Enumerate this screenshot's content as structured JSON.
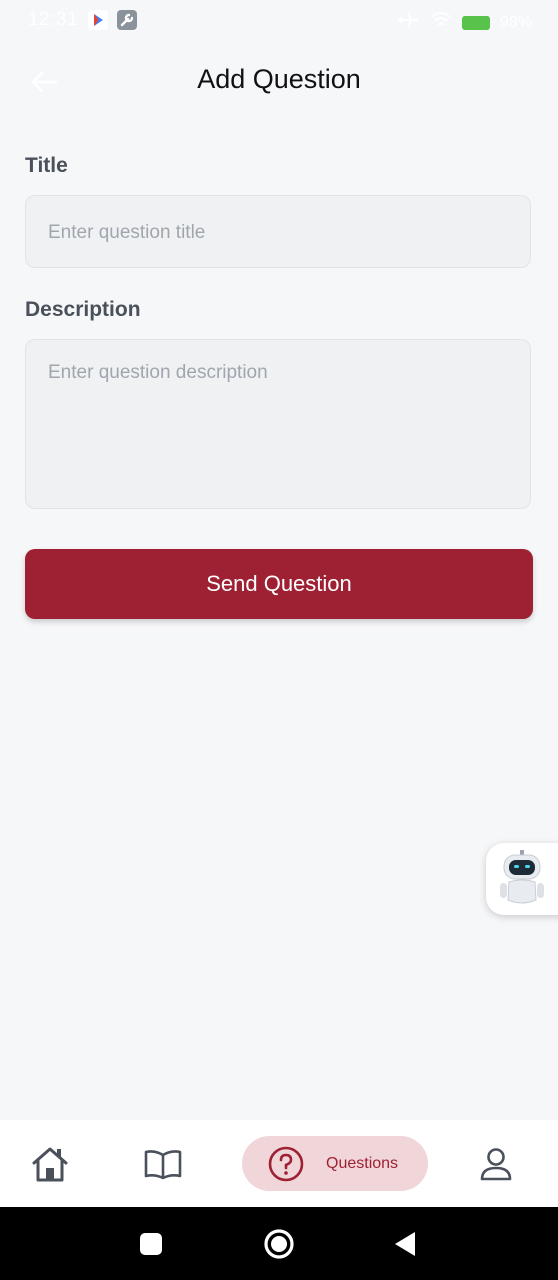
{
  "status_bar": {
    "time": "12:31",
    "battery": "98%"
  },
  "header": {
    "title": "Add Question"
  },
  "form": {
    "title_label": "Title",
    "title_placeholder": "Enter question title",
    "description_label": "Description",
    "description_placeholder": "Enter question description",
    "submit_label": "Send Question"
  },
  "bottom_nav": {
    "items": [
      {
        "icon": "home-icon",
        "active": false
      },
      {
        "icon": "book-icon",
        "active": false
      },
      {
        "icon": "question-icon",
        "label": "Questions",
        "active": true
      },
      {
        "icon": "profile-icon",
        "active": false
      }
    ]
  },
  "colors": {
    "brand": "#9e2033",
    "background": "#f6f7f9",
    "active_pill": "#f0d5d9"
  }
}
